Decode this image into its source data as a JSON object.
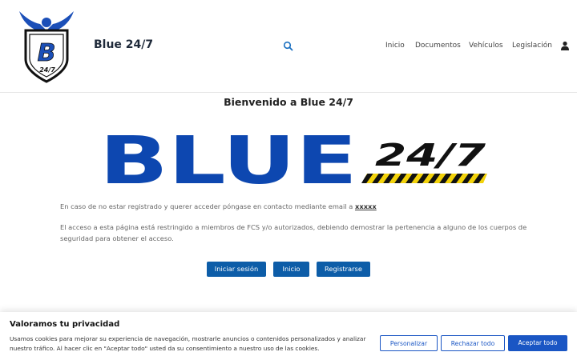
{
  "header": {
    "site_title": "Blue 24/7",
    "logo_text": "B",
    "logo_subtext": "24/7",
    "nav": [
      "Inicio",
      "Documentos",
      "Vehículos",
      "Legislación"
    ]
  },
  "main": {
    "welcome": "Bienvenido a Blue 24/7",
    "banner_word": "BLUE",
    "banner_suffix": "24/7",
    "contact_text": "En caso de no estar registrado y querer acceder póngase en contacto mediante email a",
    "contact_email": "xxxxx",
    "restricted_text": "El acceso a esta página está restringido a miembros de FCS y/o autorizados, debiendo demostrar la pertenencia a alguno de los cuerpos de seguridad para obtener el acceso.",
    "buttons": [
      "Iniciar sesión",
      "Inicio",
      "Registrarse"
    ]
  },
  "cookie": {
    "title": "Valoramos tu privacidad",
    "text": "Usamos cookies para mejorar su experiencia de navegación, mostrarle anuncios o contenidos personalizados y analizar nuestro tráfico. Al hacer clic en \"Aceptar todo\" usted da su consentimiento a nuestro uso de las cookies.",
    "customize": "Personalizar",
    "reject": "Rechazar todo",
    "accept": "Aceptar todo"
  },
  "colors": {
    "brand_blue": "#0d47b0",
    "button_blue": "#0d5da8",
    "cookie_blue": "#1a56c4",
    "stripe_yellow": "#f2d20a"
  }
}
